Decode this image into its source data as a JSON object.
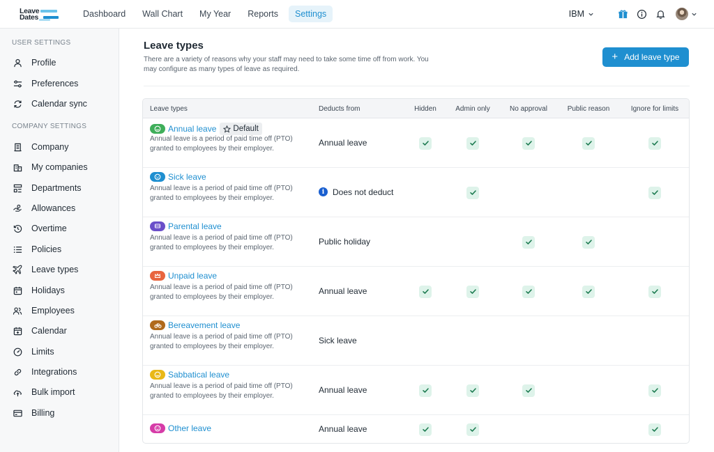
{
  "app": {
    "logo_line1": "Leave",
    "logo_line2": "Dates"
  },
  "nav": {
    "items": [
      "Dashboard",
      "Wall Chart",
      "My Year",
      "Reports",
      "Settings"
    ],
    "active": "Settings"
  },
  "topbar": {
    "org_name": "IBM",
    "icons": [
      "gift-icon",
      "info-icon",
      "bell-icon",
      "avatar"
    ]
  },
  "sidebar": {
    "user_heading": "USER SETTINGS",
    "user_items": [
      {
        "label": "Profile",
        "icon": "person-icon"
      },
      {
        "label": "Preferences",
        "icon": "sliders-icon"
      },
      {
        "label": "Calendar sync",
        "icon": "sync-icon"
      }
    ],
    "company_heading": "COMPANY SETTINGS",
    "company_items": [
      {
        "label": "Company",
        "icon": "building-icon"
      },
      {
        "label": "My companies",
        "icon": "buildings-icon"
      },
      {
        "label": "Departments",
        "icon": "org-chart-icon"
      },
      {
        "label": "Allowances",
        "icon": "hand-coins-icon"
      },
      {
        "label": "Overtime",
        "icon": "clock-rewind-icon"
      },
      {
        "label": "Policies",
        "icon": "list-icon"
      },
      {
        "label": "Leave types",
        "icon": "plane-icon"
      },
      {
        "label": "Holidays",
        "icon": "calendar-icon"
      },
      {
        "label": "Employees",
        "icon": "users-icon"
      },
      {
        "label": "Calendar",
        "icon": "calendar-plus-icon"
      },
      {
        "label": "Limits",
        "icon": "gauge-icon"
      },
      {
        "label": "Integrations",
        "icon": "link-icon"
      },
      {
        "label": "Bulk import",
        "icon": "upload-icon"
      },
      {
        "label": "Billing",
        "icon": "credit-card-icon"
      }
    ]
  },
  "page": {
    "title": "Leave types",
    "description": "There are a variety of reasons why your staff may need to take some time off from work. You may configure as many types of leave as required.",
    "add_button": "Add leave type"
  },
  "table": {
    "columns": [
      "Leave types",
      "Deducts from",
      "Hidden",
      "Admin only",
      "No approval",
      "Public reason",
      "Ignore for limits"
    ],
    "default_label": "Default",
    "rows": [
      {
        "name": "Annual leave",
        "color": "#3fae5a",
        "icon": "smile-icon",
        "is_default": true,
        "description": "Annual leave is a period of paid time off (PTO) granted to employees by their employer.",
        "deducts": "Annual leave",
        "deducts_info": false,
        "hidden": true,
        "admin_only": true,
        "no_approval": true,
        "public_reason": true,
        "ignore_limits": true
      },
      {
        "name": "Sick leave",
        "color": "#1f8fd0",
        "icon": "face-icon",
        "is_default": false,
        "description": "Annual leave is a period of paid time off (PTO) granted to employees by their employer.",
        "deducts": "Does not deduct",
        "deducts_info": true,
        "hidden": false,
        "admin_only": true,
        "no_approval": false,
        "public_reason": false,
        "ignore_limits": true
      },
      {
        "name": "Parental leave",
        "color": "#6a4fc9",
        "icon": "stroller-icon",
        "is_default": false,
        "description": "Annual leave is a period of paid time off (PTO) granted to employees by their employer.",
        "deducts": "Public holiday",
        "deducts_info": false,
        "hidden": false,
        "admin_only": false,
        "no_approval": true,
        "public_reason": true,
        "ignore_limits": false
      },
      {
        "name": "Unpaid leave",
        "color": "#e8653f",
        "icon": "crown-icon",
        "is_default": false,
        "description": "Annual leave is a period of paid time off (PTO) granted to employees by their employer.",
        "deducts": "Annual leave",
        "deducts_info": false,
        "hidden": true,
        "admin_only": true,
        "no_approval": true,
        "public_reason": true,
        "ignore_limits": true
      },
      {
        "name": "Bereavement leave",
        "color": "#b06a1c",
        "icon": "bike-icon",
        "is_default": false,
        "description": "Annual leave is a period of paid time off (PTO) granted to employees by their employer.",
        "deducts": "Sick leave",
        "deducts_info": false,
        "hidden": false,
        "admin_only": false,
        "no_approval": false,
        "public_reason": false,
        "ignore_limits": false
      },
      {
        "name": "Sabbatical leave",
        "color": "#e9b817",
        "icon": "smile-icon",
        "is_default": false,
        "description": "Annual leave is a period of paid time off (PTO) granted to employees by their employer.",
        "deducts": "Annual leave",
        "deducts_info": false,
        "hidden": true,
        "admin_only": true,
        "no_approval": true,
        "public_reason": false,
        "ignore_limits": true
      },
      {
        "name": "Other leave",
        "color": "#d63ca8",
        "icon": "face-icon",
        "is_default": false,
        "description": "",
        "deducts": "Annual leave",
        "deducts_info": false,
        "hidden": true,
        "admin_only": true,
        "no_approval": false,
        "public_reason": false,
        "ignore_limits": true
      }
    ]
  }
}
